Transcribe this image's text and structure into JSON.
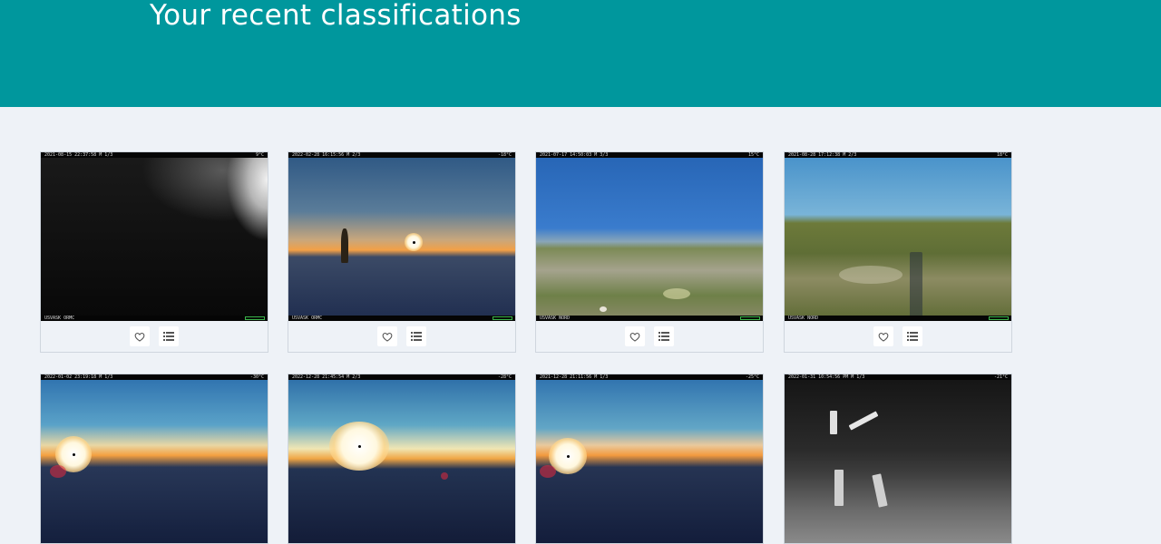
{
  "header": {
    "title": "Your recent classifications"
  },
  "colors": {
    "banner": "#00979d",
    "page_bg": "#eef2f7"
  },
  "cards": [
    {
      "stamp_left": "2021-08-15 22:37:58    M 1/3",
      "stamp_right": "9°C",
      "location": "USVASK ORMC",
      "favorite_icon": "heart-outline-icon",
      "collection_icon": "list-icon"
    },
    {
      "stamp_left": "2022-02-28 16:15:56    M 2/3",
      "stamp_right": "-18°C",
      "location": "USVASK ORMC",
      "favorite_icon": "heart-outline-icon",
      "collection_icon": "list-icon"
    },
    {
      "stamp_left": "2021-07-17 14:50:03    M 3/3",
      "stamp_right": "15°C",
      "location": "USVASK NORD",
      "favorite_icon": "heart-outline-icon",
      "collection_icon": "list-icon"
    },
    {
      "stamp_left": "2021-08-28 17:12:38    M 2/3",
      "stamp_right": "18°C",
      "location": "USVASK NORD",
      "favorite_icon": "heart-outline-icon",
      "collection_icon": "list-icon"
    },
    {
      "stamp_left": "2022-01-02 23:19:18    M 1/3",
      "stamp_right": "-30°C"
    },
    {
      "stamp_left": "2022-12-28 21:45:54    M 2/3",
      "stamp_right": "-28°C"
    },
    {
      "stamp_left": "2021-12-28 21:11:56    M 1/3",
      "stamp_right": "-25°C"
    },
    {
      "stamp_left": "2022-01-31 10:54:56 PM  M 1/3",
      "stamp_right": "-21°C"
    }
  ]
}
